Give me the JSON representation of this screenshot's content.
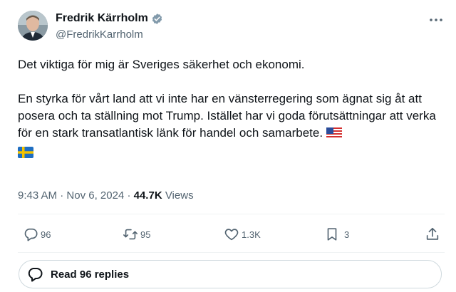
{
  "author": {
    "name": "Fredrik Kärrholm",
    "handle": "@FredrikKarrholm",
    "verified_color": "#829aab"
  },
  "tweet": {
    "line1": "Det viktiga för mig är Sveriges säkerhet och ekonomi.",
    "line2": "En styrka för vårt land att vi inte har en vänsterregering som ägnat sig åt att posera och ta ställning mot Trump. Istället har vi goda förutsättningar att verka för en stark transatlantisk länk för handel och samarbete.",
    "flags": [
      "us-flag-icon",
      "sweden-flag-icon"
    ]
  },
  "meta": {
    "time": "9:43 AM",
    "date": "Nov 6, 2024",
    "views_count": "44.7K",
    "views_label": "Views",
    "separator": "·"
  },
  "actions": {
    "replies": "96",
    "reposts": "95",
    "likes": "1.3K",
    "bookmarks": "3"
  },
  "read_replies_label": "Read 96 replies",
  "colors": {
    "text": "#0f1419",
    "secondary": "#536471",
    "border": "#cfd9de"
  }
}
